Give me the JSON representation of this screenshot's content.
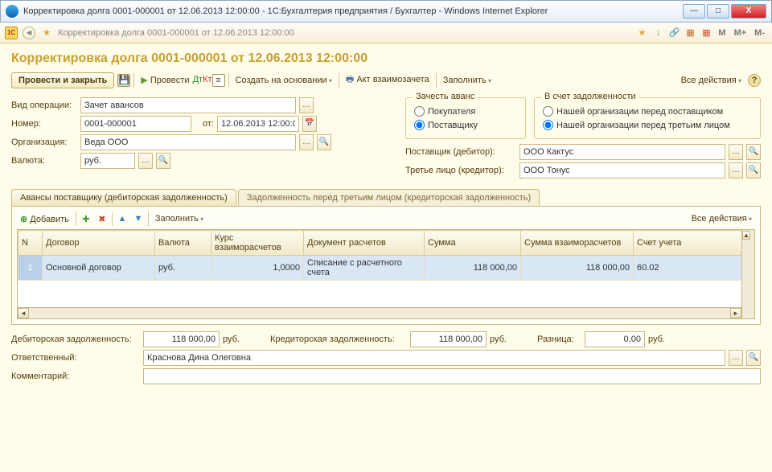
{
  "window": {
    "title": "Корректировка долга 0001-000001 от 12.06.2013 12:00:00 - 1С:Бухгалтерия предприятия / Бухгалтер - Windows Internet Explorer"
  },
  "toolbar1": {
    "crumb": "Корректировка долга 0001-000001 от 12.06.2013 12:00:00",
    "m": "M",
    "mplus": "M+",
    "mminus": "M-"
  },
  "page_title": "Корректировка долга 0001-000001 от 12.06.2013 12:00:00",
  "main_toolbar": {
    "post_close": "Провести и закрыть",
    "post": "Провести",
    "create_based": "Создать на основании",
    "act": "Акт взаимозачета",
    "fill": "Заполнить",
    "all_actions": "Все действия"
  },
  "form": {
    "op_type_lbl": "Вид операции:",
    "op_type": "Зачет авансов",
    "number_lbl": "Номер:",
    "number": "0001-000001",
    "from_lbl": "от:",
    "date": "12.06.2013 12:00:00",
    "org_lbl": "Организация:",
    "org": "Веда ООО",
    "currency_lbl": "Валюта:",
    "currency": "руб.",
    "advance_legend": "Зачесть аванс",
    "adv_buyer": "Покупателя",
    "adv_supplier": "Поставщику",
    "debt_legend": "В счет задолженности",
    "debt_our_supplier": "Нашей организации перед поставщиком",
    "debt_our_third": "Нашей организации перед третьим лицом",
    "supplier_lbl": "Поставщик (дебитор):",
    "supplier": "ООО Кактус",
    "third_lbl": "Третье лицо (кредитор):",
    "third": "ООО Тонус"
  },
  "tabs": {
    "t1": "Авансы поставщику (дебиторская задолженность)",
    "t2": "Задолженность перед третьим лицом (кредиторская задолженность)"
  },
  "tabtb": {
    "add": "Добавить",
    "fill": "Заполнить",
    "all_actions": "Все действия"
  },
  "grid": {
    "cols": {
      "n": "N",
      "contract": "Договор",
      "curr": "Валюта",
      "rate": "Курс взаиморасчетов",
      "doc": "Документ расчетов",
      "sum": "Сумма",
      "sum2": "Сумма взаиморасчетов",
      "acc": "Счет учета"
    },
    "row": {
      "n": "1",
      "contract": "Основной договор",
      "curr": "руб.",
      "rate": "1,0000",
      "doc": "Списание с расчетного счета",
      "sum": "118 000,00",
      "sum2": "118 000,00",
      "acc": "60.02"
    }
  },
  "bottom": {
    "deb_lbl": "Дебиторская задолженность:",
    "deb": "118 000,00",
    "rub": "руб.",
    "cred_lbl": "Кредиторская задолженность:",
    "cred": "118 000,00",
    "diff_lbl": "Разница:",
    "diff": "0,00",
    "resp_lbl": "Ответственный:",
    "resp": "Краснова Дина Олеговна",
    "comment_lbl": "Комментарий:",
    "comment": ""
  }
}
